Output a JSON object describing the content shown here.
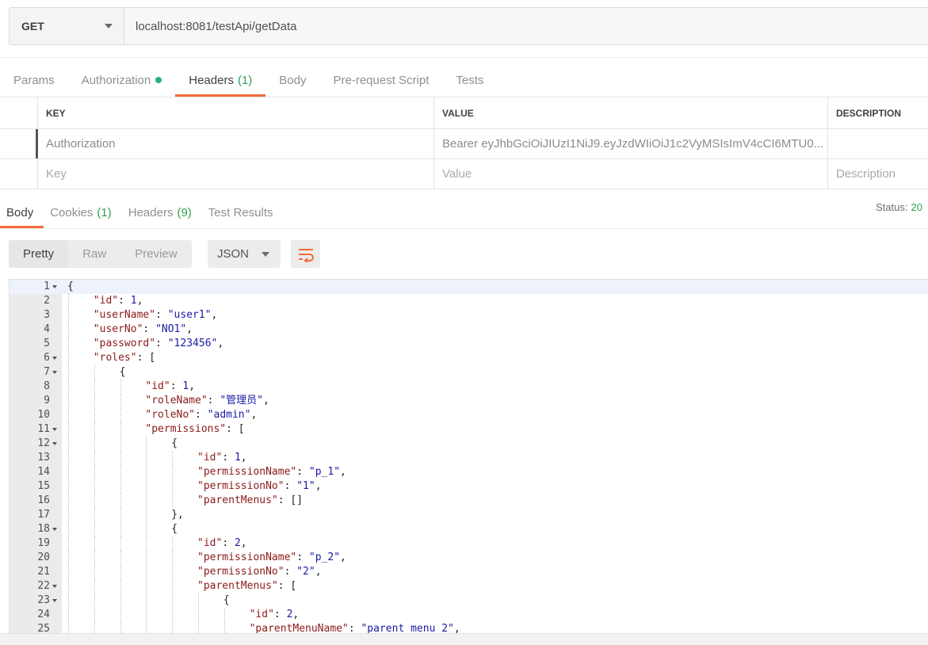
{
  "request": {
    "method": "GET",
    "url": "localhost:8081/testApi/getData"
  },
  "request_tabs": [
    {
      "label": "Params",
      "count": ""
    },
    {
      "label": "Authorization",
      "count": ""
    },
    {
      "label": "Headers",
      "count": "(1)"
    },
    {
      "label": "Body",
      "count": ""
    },
    {
      "label": "Pre-request Script",
      "count": ""
    },
    {
      "label": "Tests",
      "count": ""
    }
  ],
  "headers_table": {
    "columns": [
      "KEY",
      "VALUE",
      "DESCRIPTION"
    ],
    "rows": [
      {
        "key": "Authorization",
        "value": "Bearer eyJhbGciOiJIUzI1NiJ9.eyJzdWIiOiJ1c2VyMSIsImV4cCI6MTU0...",
        "description": ""
      }
    ],
    "placeholder": {
      "key": "Key",
      "value": "Value",
      "description": "Description"
    }
  },
  "response_tabs": [
    {
      "label": "Body",
      "count": ""
    },
    {
      "label": "Cookies",
      "count": "(1)"
    },
    {
      "label": "Headers",
      "count": "(9)"
    },
    {
      "label": "Test Results",
      "count": ""
    }
  ],
  "status": {
    "label": "Status:",
    "code": "20"
  },
  "view_modes": [
    "Pretty",
    "Raw",
    "Preview"
  ],
  "format": "JSON",
  "icons": {
    "dropdown": "chevron-down-icon",
    "wrap": "wrap-lines-icon",
    "auth_indicator": "status-dot-icon"
  },
  "colors": {
    "accent": "#f26b3a",
    "success": "#26b47a",
    "json_key": "#8b1a1a",
    "json_value": "#1a1aa6"
  },
  "code_lines": [
    {
      "n": 1,
      "indent": 0,
      "fold": true,
      "parts": [
        [
          "p",
          "{"
        ]
      ]
    },
    {
      "n": 2,
      "indent": 1,
      "fold": false,
      "parts": [
        [
          "k",
          "\"id\""
        ],
        [
          "p",
          ": "
        ],
        [
          "n",
          "1"
        ],
        [
          "p",
          ","
        ]
      ]
    },
    {
      "n": 3,
      "indent": 1,
      "fold": false,
      "parts": [
        [
          "k",
          "\"userName\""
        ],
        [
          "p",
          ": "
        ],
        [
          "s",
          "\"user1\""
        ],
        [
          "p",
          ","
        ]
      ]
    },
    {
      "n": 4,
      "indent": 1,
      "fold": false,
      "parts": [
        [
          "k",
          "\"userNo\""
        ],
        [
          "p",
          ": "
        ],
        [
          "s",
          "\"NO1\""
        ],
        [
          "p",
          ","
        ]
      ]
    },
    {
      "n": 5,
      "indent": 1,
      "fold": false,
      "parts": [
        [
          "k",
          "\"password\""
        ],
        [
          "p",
          ": "
        ],
        [
          "s",
          "\"123456\""
        ],
        [
          "p",
          ","
        ]
      ]
    },
    {
      "n": 6,
      "indent": 1,
      "fold": true,
      "parts": [
        [
          "k",
          "\"roles\""
        ],
        [
          "p",
          ": ["
        ]
      ]
    },
    {
      "n": 7,
      "indent": 2,
      "fold": true,
      "parts": [
        [
          "p",
          "{"
        ]
      ]
    },
    {
      "n": 8,
      "indent": 3,
      "fold": false,
      "parts": [
        [
          "k",
          "\"id\""
        ],
        [
          "p",
          ": "
        ],
        [
          "n",
          "1"
        ],
        [
          "p",
          ","
        ]
      ]
    },
    {
      "n": 9,
      "indent": 3,
      "fold": false,
      "parts": [
        [
          "k",
          "\"roleName\""
        ],
        [
          "p",
          ": "
        ],
        [
          "s",
          "\"管理员\""
        ],
        [
          "p",
          ","
        ]
      ]
    },
    {
      "n": 10,
      "indent": 3,
      "fold": false,
      "parts": [
        [
          "k",
          "\"roleNo\""
        ],
        [
          "p",
          ": "
        ],
        [
          "s",
          "\"admin\""
        ],
        [
          "p",
          ","
        ]
      ]
    },
    {
      "n": 11,
      "indent": 3,
      "fold": true,
      "parts": [
        [
          "k",
          "\"permissions\""
        ],
        [
          "p",
          ": ["
        ]
      ]
    },
    {
      "n": 12,
      "indent": 4,
      "fold": true,
      "parts": [
        [
          "p",
          "{"
        ]
      ]
    },
    {
      "n": 13,
      "indent": 5,
      "fold": false,
      "parts": [
        [
          "k",
          "\"id\""
        ],
        [
          "p",
          ": "
        ],
        [
          "n",
          "1"
        ],
        [
          "p",
          ","
        ]
      ]
    },
    {
      "n": 14,
      "indent": 5,
      "fold": false,
      "parts": [
        [
          "k",
          "\"permissionName\""
        ],
        [
          "p",
          ": "
        ],
        [
          "s",
          "\"p_1\""
        ],
        [
          "p",
          ","
        ]
      ]
    },
    {
      "n": 15,
      "indent": 5,
      "fold": false,
      "parts": [
        [
          "k",
          "\"permissionNo\""
        ],
        [
          "p",
          ": "
        ],
        [
          "s",
          "\"1\""
        ],
        [
          "p",
          ","
        ]
      ]
    },
    {
      "n": 16,
      "indent": 5,
      "fold": false,
      "parts": [
        [
          "k",
          "\"parentMenus\""
        ],
        [
          "p",
          ": []"
        ]
      ]
    },
    {
      "n": 17,
      "indent": 4,
      "fold": false,
      "parts": [
        [
          "p",
          "},"
        ]
      ]
    },
    {
      "n": 18,
      "indent": 4,
      "fold": true,
      "parts": [
        [
          "p",
          "{"
        ]
      ]
    },
    {
      "n": 19,
      "indent": 5,
      "fold": false,
      "parts": [
        [
          "k",
          "\"id\""
        ],
        [
          "p",
          ": "
        ],
        [
          "n",
          "2"
        ],
        [
          "p",
          ","
        ]
      ]
    },
    {
      "n": 20,
      "indent": 5,
      "fold": false,
      "parts": [
        [
          "k",
          "\"permissionName\""
        ],
        [
          "p",
          ": "
        ],
        [
          "s",
          "\"p_2\""
        ],
        [
          "p",
          ","
        ]
      ]
    },
    {
      "n": 21,
      "indent": 5,
      "fold": false,
      "parts": [
        [
          "k",
          "\"permissionNo\""
        ],
        [
          "p",
          ": "
        ],
        [
          "s",
          "\"2\""
        ],
        [
          "p",
          ","
        ]
      ]
    },
    {
      "n": 22,
      "indent": 5,
      "fold": true,
      "parts": [
        [
          "k",
          "\"parentMenus\""
        ],
        [
          "p",
          ": ["
        ]
      ]
    },
    {
      "n": 23,
      "indent": 6,
      "fold": true,
      "parts": [
        [
          "p",
          "{"
        ]
      ]
    },
    {
      "n": 24,
      "indent": 7,
      "fold": false,
      "parts": [
        [
          "k",
          "\"id\""
        ],
        [
          "p",
          ": "
        ],
        [
          "n",
          "2"
        ],
        [
          "p",
          ","
        ]
      ]
    },
    {
      "n": 25,
      "indent": 7,
      "fold": false,
      "parts": [
        [
          "k",
          "\"parentMenuName\""
        ],
        [
          "p",
          ": "
        ],
        [
          "s",
          "\"parent menu 2\""
        ],
        [
          "p",
          ","
        ]
      ]
    }
  ]
}
